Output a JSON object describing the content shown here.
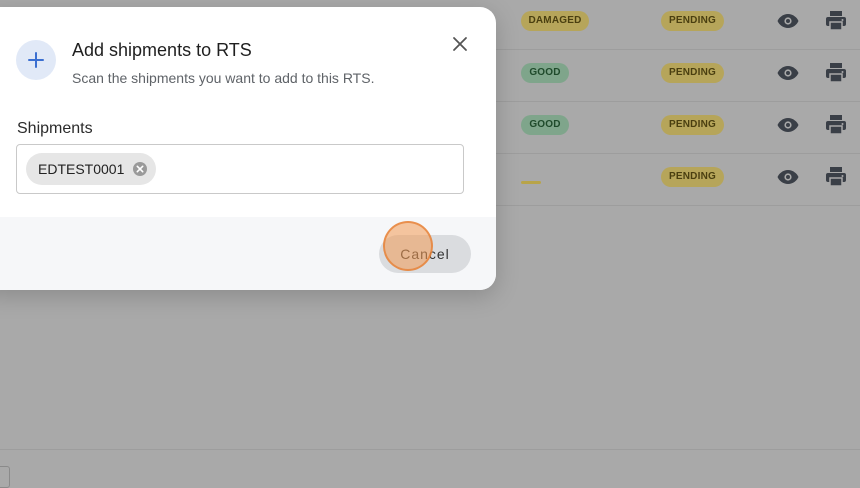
{
  "background_table": {
    "rows": [
      {
        "condition": "DAMAGED",
        "condition_type": "damaged",
        "status": "PENDING"
      },
      {
        "condition": "GOOD",
        "condition_type": "good",
        "status": "PENDING"
      },
      {
        "condition": "GOOD",
        "condition_type": "good",
        "status": "PENDING"
      },
      {
        "condition": "",
        "condition_type": "none",
        "status": "PENDING"
      }
    ],
    "row_icons": [
      "eye-icon",
      "printer-icon"
    ]
  },
  "dialog": {
    "icon": "plus-icon",
    "title": "Add shipments to RTS",
    "subtitle": "Scan the shipments you want to add to this RTS.",
    "close_icon": "close-icon",
    "field_label": "Shipments",
    "chips": [
      "EDTEST0001"
    ],
    "chip_remove_icon": "cancel-circle-icon",
    "cancel_label": "Cancel"
  },
  "colors": {
    "overlay_bg": "#a9a9a9",
    "badge_pending": "#b6a55a",
    "badge_good": "#7fa58b",
    "accent_blue": "#3b6fd1",
    "click_indicator": "#f39b53"
  }
}
